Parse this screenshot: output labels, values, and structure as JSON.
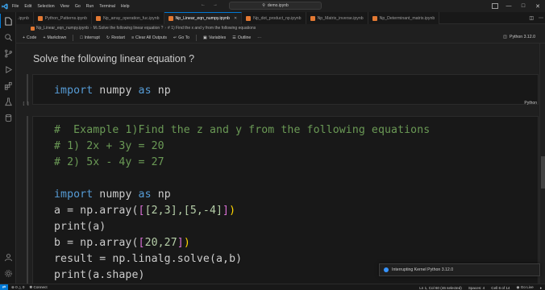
{
  "titlebar": {
    "menus": [
      "File",
      "Edit",
      "Selection",
      "View",
      "Go",
      "Run",
      "Terminal",
      "Help"
    ],
    "search": "demo.ipynb"
  },
  "tabs": [
    {
      "label": ".ipynb",
      "active": false
    },
    {
      "label": "Python_Patterns.ipynb",
      "active": false
    },
    {
      "label": "Np_array_operation_fuc.ipynb",
      "active": false
    },
    {
      "label": "Np_Linear_eqn_numpy.ipynb",
      "active": true
    },
    {
      "label": "Np_dot_product_np.ipynb",
      "active": false
    },
    {
      "label": "Np_Matrix_inverse.ipynb",
      "active": false
    },
    {
      "label": "Np_Determinant_matrix.ipynb",
      "active": false
    }
  ],
  "breadcrumb": [
    "Np_Linear_eqn_numpy.ipynb",
    "M↓Solve the following linear equation ?",
    "# 1) Find the x and y from the following equations"
  ],
  "toolbar": {
    "code": "Code",
    "markdown": "Markdown",
    "interrupt": "Interrupt",
    "restart": "Restart",
    "clear_all_outputs": "Clear All Outputs",
    "goto": "Go To",
    "variables": "Variables",
    "outline": "Outline",
    "kernel": "Python 3.12.0"
  },
  "notebook": {
    "markdown_heading": "Solve the following linear equation ?",
    "cell1": {
      "exec_label": "[ ]",
      "language": "Python",
      "line": {
        "kw1": "import",
        "mod": "numpy",
        "kw2": "as",
        "alias": "np"
      }
    },
    "cell2": {
      "comment1": "#  Example 1)Find the z and y from the following equations",
      "comment2": "# 1) 2x + 3y = 20",
      "comment3": "# 2) 5x - 4y = 27",
      "import_kw": "import",
      "import_mod": "numpy",
      "import_as": "as",
      "import_alias": "np",
      "line_a": "a = np.array(",
      "line_a_args": "[2,3],[5,-4]",
      "print_a": "print(a)",
      "line_b": "b = np.array(",
      "line_b_args": "20,27",
      "line_result": "result = np.linalg.solve(a,b)",
      "print_shape": "print(a.shape)"
    }
  },
  "notification": {
    "text": "Interrupting Kernel Python 3.12.0"
  },
  "statusbar": {
    "errors": "0",
    "warnings": "0",
    "connect": "Connect",
    "position": "Ln 1, Col 60 (46 selected)",
    "spaces": "Spaces: 4",
    "cell": "Cell 6 of 14",
    "golive": "Go Live"
  },
  "colors": {
    "accent": "#0078d4",
    "keyword": "#569cd6",
    "comment": "#6a9955",
    "number": "#b5cea8"
  }
}
